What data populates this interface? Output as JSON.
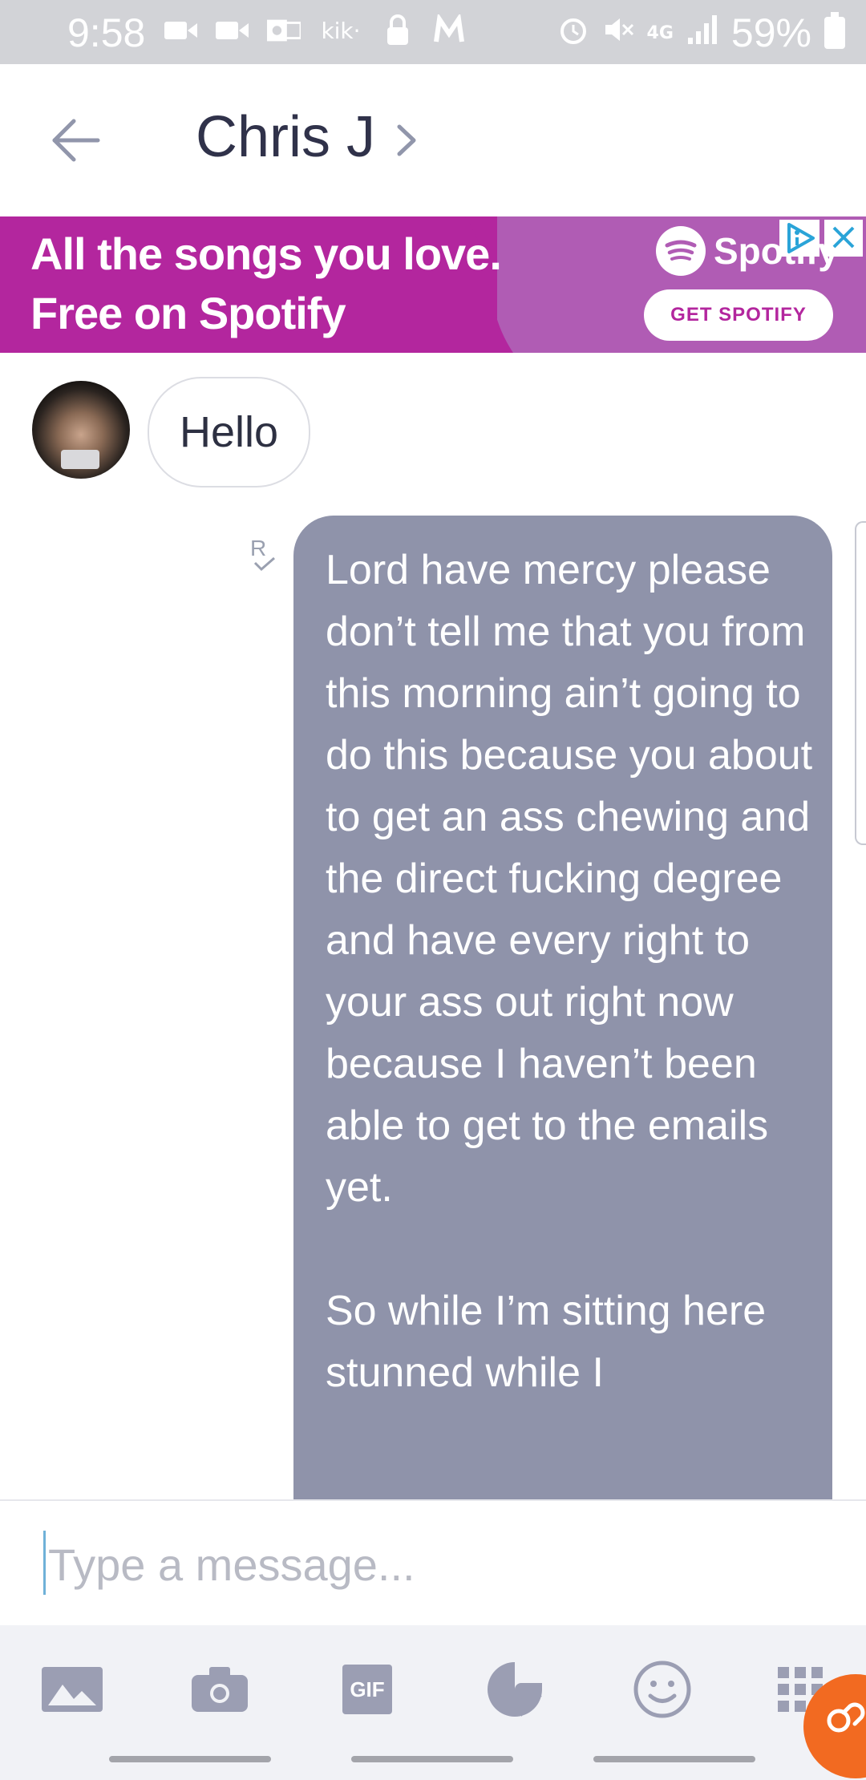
{
  "status_bar": {
    "time": "9:58",
    "battery_percent": "59%",
    "left_icons": [
      "video-icon",
      "video-icon",
      "outlook-icon",
      "kik-icon",
      "lock-icon",
      "maps-icon"
    ],
    "right_icons": [
      "alarm-icon",
      "mute-icon",
      "4g-lte-icon",
      "signal-icon",
      "battery-icon"
    ],
    "kik_label": "kik·"
  },
  "header": {
    "contact_name": "Chris J"
  },
  "ad": {
    "headline_line1": "All the songs you love.",
    "headline_line2": "Free on Spotify",
    "brand": "Spotify",
    "cta": "GET SPOTIFY",
    "colors": {
      "primary": "#b3269e",
      "secondary": "#b05cb4"
    }
  },
  "conversation": {
    "incoming": [
      {
        "text": "Hello"
      }
    ],
    "read_receipt": "R",
    "outgoing": [
      {
        "text": "Lord have mercy please don’t tell me that you from this morning ain’t going to do this because you about to get an ass chewing and the direct fucking degree and have every right to your ass out right now because I haven’t been able to get to the emails yet.\n\nSo while I’m sitting here stunned while I"
      }
    ]
  },
  "composer": {
    "placeholder": "Type a message..."
  },
  "toolbar": {
    "gif_label": "GIF",
    "tools": [
      "gallery-icon",
      "camera-icon",
      "gif-icon",
      "sticker-icon",
      "emoji-icon",
      "apps-grid-icon"
    ]
  },
  "colors": {
    "outgoing_bubble": "#8f93aa",
    "accent_fab": "#f26a21"
  }
}
